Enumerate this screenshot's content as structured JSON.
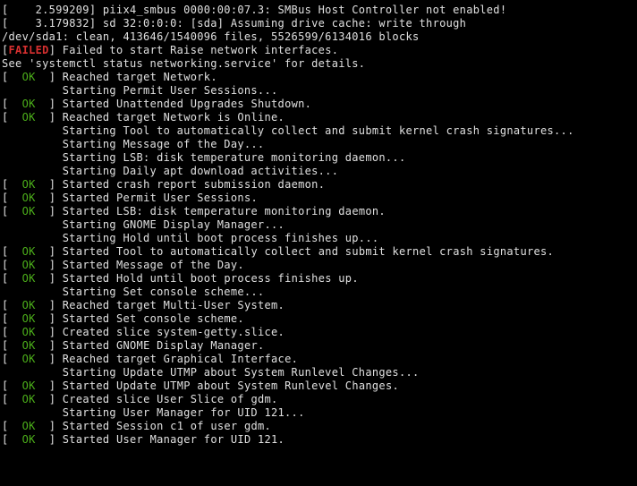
{
  "boot_messages": [
    "[    2.599209] piix4_smbus 0000:00:07.3: SMBus Host Controller not enabled!",
    "[    3.179832] sd 32:0:0:0: [sda] Assuming drive cache: write through",
    "/dev/sda1: clean, 413646/1540096 files, 5526599/6134016 blocks"
  ],
  "status_lines": [
    {
      "status": "FAILED",
      "text": "Failed to start Raise network interfaces."
    },
    {
      "status": null,
      "text": "See 'systemctl status networking.service' for details.",
      "flush": true
    },
    {
      "status": "OK",
      "text": "Reached target Network."
    },
    {
      "status": null,
      "text": "Starting Permit User Sessions..."
    },
    {
      "status": "OK",
      "text": "Started Unattended Upgrades Shutdown."
    },
    {
      "status": "OK",
      "text": "Reached target Network is Online."
    },
    {
      "status": null,
      "text": "Starting Tool to automatically collect and submit kernel crash signatures..."
    },
    {
      "status": null,
      "text": "Starting Message of the Day..."
    },
    {
      "status": null,
      "text": "Starting LSB: disk temperature monitoring daemon..."
    },
    {
      "status": null,
      "text": "Starting Daily apt download activities..."
    },
    {
      "status": "OK",
      "text": "Started crash report submission daemon."
    },
    {
      "status": "OK",
      "text": "Started Permit User Sessions."
    },
    {
      "status": "OK",
      "text": "Started LSB: disk temperature monitoring daemon."
    },
    {
      "status": null,
      "text": "Starting GNOME Display Manager..."
    },
    {
      "status": null,
      "text": "Starting Hold until boot process finishes up..."
    },
    {
      "status": "OK",
      "text": "Started Tool to automatically collect and submit kernel crash signatures."
    },
    {
      "status": "OK",
      "text": "Started Message of the Day."
    },
    {
      "status": "OK",
      "text": "Started Hold until boot process finishes up."
    },
    {
      "status": null,
      "text": "Starting Set console scheme..."
    },
    {
      "status": "OK",
      "text": "Reached target Multi-User System."
    },
    {
      "status": "OK",
      "text": "Started Set console scheme."
    },
    {
      "status": "OK",
      "text": "Created slice system-getty.slice."
    },
    {
      "status": "OK",
      "text": "Started GNOME Display Manager."
    },
    {
      "status": "OK",
      "text": "Reached target Graphical Interface."
    },
    {
      "status": null,
      "text": "Starting Update UTMP about System Runlevel Changes..."
    },
    {
      "status": "OK",
      "text": "Started Update UTMP about System Runlevel Changes."
    },
    {
      "status": "OK",
      "text": "Created slice User Slice of gdm."
    },
    {
      "status": null,
      "text": "Starting User Manager for UID 121..."
    },
    {
      "status": "OK",
      "text": "Started Session c1 of user gdm."
    },
    {
      "status": "OK",
      "text": "Started User Manager for UID 121."
    }
  ]
}
